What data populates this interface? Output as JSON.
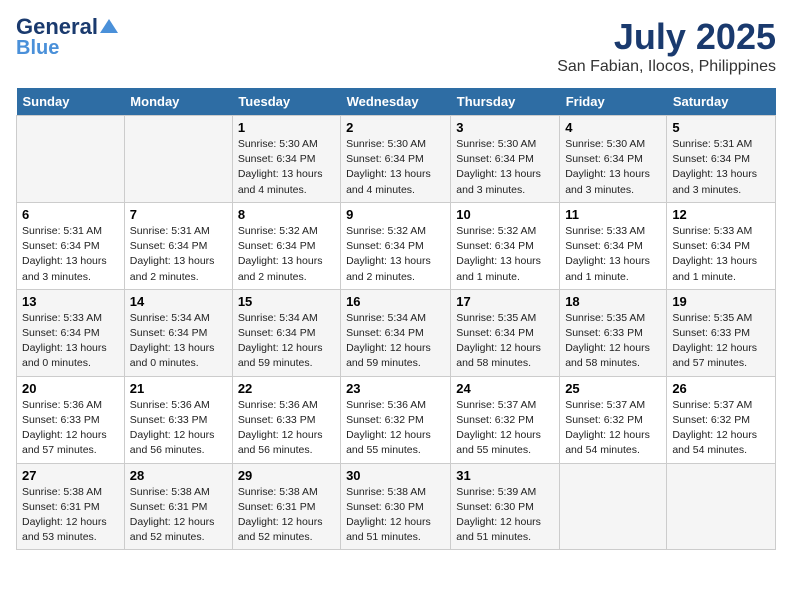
{
  "logo": {
    "line1": "General",
    "line2": "Blue"
  },
  "header": {
    "month_year": "July 2025",
    "location": "San Fabian, Ilocos, Philippines"
  },
  "weekdays": [
    "Sunday",
    "Monday",
    "Tuesday",
    "Wednesday",
    "Thursday",
    "Friday",
    "Saturday"
  ],
  "weeks": [
    [
      {
        "day": "",
        "info": ""
      },
      {
        "day": "",
        "info": ""
      },
      {
        "day": "1",
        "info": "Sunrise: 5:30 AM\nSunset: 6:34 PM\nDaylight: 13 hours and 4 minutes."
      },
      {
        "day": "2",
        "info": "Sunrise: 5:30 AM\nSunset: 6:34 PM\nDaylight: 13 hours and 4 minutes."
      },
      {
        "day": "3",
        "info": "Sunrise: 5:30 AM\nSunset: 6:34 PM\nDaylight: 13 hours and 3 minutes."
      },
      {
        "day": "4",
        "info": "Sunrise: 5:30 AM\nSunset: 6:34 PM\nDaylight: 13 hours and 3 minutes."
      },
      {
        "day": "5",
        "info": "Sunrise: 5:31 AM\nSunset: 6:34 PM\nDaylight: 13 hours and 3 minutes."
      }
    ],
    [
      {
        "day": "6",
        "info": "Sunrise: 5:31 AM\nSunset: 6:34 PM\nDaylight: 13 hours and 3 minutes."
      },
      {
        "day": "7",
        "info": "Sunrise: 5:31 AM\nSunset: 6:34 PM\nDaylight: 13 hours and 2 minutes."
      },
      {
        "day": "8",
        "info": "Sunrise: 5:32 AM\nSunset: 6:34 PM\nDaylight: 13 hours and 2 minutes."
      },
      {
        "day": "9",
        "info": "Sunrise: 5:32 AM\nSunset: 6:34 PM\nDaylight: 13 hours and 2 minutes."
      },
      {
        "day": "10",
        "info": "Sunrise: 5:32 AM\nSunset: 6:34 PM\nDaylight: 13 hours and 1 minute."
      },
      {
        "day": "11",
        "info": "Sunrise: 5:33 AM\nSunset: 6:34 PM\nDaylight: 13 hours and 1 minute."
      },
      {
        "day": "12",
        "info": "Sunrise: 5:33 AM\nSunset: 6:34 PM\nDaylight: 13 hours and 1 minute."
      }
    ],
    [
      {
        "day": "13",
        "info": "Sunrise: 5:33 AM\nSunset: 6:34 PM\nDaylight: 13 hours and 0 minutes."
      },
      {
        "day": "14",
        "info": "Sunrise: 5:34 AM\nSunset: 6:34 PM\nDaylight: 13 hours and 0 minutes."
      },
      {
        "day": "15",
        "info": "Sunrise: 5:34 AM\nSunset: 6:34 PM\nDaylight: 12 hours and 59 minutes."
      },
      {
        "day": "16",
        "info": "Sunrise: 5:34 AM\nSunset: 6:34 PM\nDaylight: 12 hours and 59 minutes."
      },
      {
        "day": "17",
        "info": "Sunrise: 5:35 AM\nSunset: 6:34 PM\nDaylight: 12 hours and 58 minutes."
      },
      {
        "day": "18",
        "info": "Sunrise: 5:35 AM\nSunset: 6:33 PM\nDaylight: 12 hours and 58 minutes."
      },
      {
        "day": "19",
        "info": "Sunrise: 5:35 AM\nSunset: 6:33 PM\nDaylight: 12 hours and 57 minutes."
      }
    ],
    [
      {
        "day": "20",
        "info": "Sunrise: 5:36 AM\nSunset: 6:33 PM\nDaylight: 12 hours and 57 minutes."
      },
      {
        "day": "21",
        "info": "Sunrise: 5:36 AM\nSunset: 6:33 PM\nDaylight: 12 hours and 56 minutes."
      },
      {
        "day": "22",
        "info": "Sunrise: 5:36 AM\nSunset: 6:33 PM\nDaylight: 12 hours and 56 minutes."
      },
      {
        "day": "23",
        "info": "Sunrise: 5:36 AM\nSunset: 6:32 PM\nDaylight: 12 hours and 55 minutes."
      },
      {
        "day": "24",
        "info": "Sunrise: 5:37 AM\nSunset: 6:32 PM\nDaylight: 12 hours and 55 minutes."
      },
      {
        "day": "25",
        "info": "Sunrise: 5:37 AM\nSunset: 6:32 PM\nDaylight: 12 hours and 54 minutes."
      },
      {
        "day": "26",
        "info": "Sunrise: 5:37 AM\nSunset: 6:32 PM\nDaylight: 12 hours and 54 minutes."
      }
    ],
    [
      {
        "day": "27",
        "info": "Sunrise: 5:38 AM\nSunset: 6:31 PM\nDaylight: 12 hours and 53 minutes."
      },
      {
        "day": "28",
        "info": "Sunrise: 5:38 AM\nSunset: 6:31 PM\nDaylight: 12 hours and 52 minutes."
      },
      {
        "day": "29",
        "info": "Sunrise: 5:38 AM\nSunset: 6:31 PM\nDaylight: 12 hours and 52 minutes."
      },
      {
        "day": "30",
        "info": "Sunrise: 5:38 AM\nSunset: 6:30 PM\nDaylight: 12 hours and 51 minutes."
      },
      {
        "day": "31",
        "info": "Sunrise: 5:39 AM\nSunset: 6:30 PM\nDaylight: 12 hours and 51 minutes."
      },
      {
        "day": "",
        "info": ""
      },
      {
        "day": "",
        "info": ""
      }
    ]
  ]
}
